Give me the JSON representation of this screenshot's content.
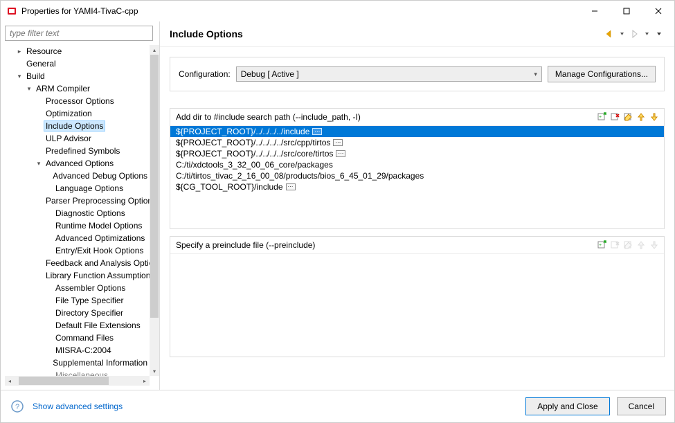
{
  "window": {
    "title": "Properties for YAMI4-TivaC-cpp"
  },
  "filter_placeholder": "type filter text",
  "tree": {
    "resource": "Resource",
    "general": "General",
    "build": "Build",
    "arm_compiler": "ARM Compiler",
    "processor_options": "Processor Options",
    "optimization": "Optimization",
    "include_options": "Include Options",
    "ulp_advisor": "ULP Advisor",
    "predefined_symbols": "Predefined Symbols",
    "advanced_options": "Advanced Options",
    "advanced_debug": "Advanced Debug Options",
    "language_options": "Language Options",
    "parser_preprocessing": "Parser Preprocessing Options",
    "diagnostic_options": "Diagnostic Options",
    "runtime_model": "Runtime Model Options",
    "advanced_optim": "Advanced Optimizations",
    "entry_exit": "Entry/Exit Hook Options",
    "feedback": "Feedback and Analysis Options",
    "library_func": "Library Function Assumptions",
    "assembler": "Assembler Options",
    "file_type": "File Type Specifier",
    "directory_spec": "Directory Specifier",
    "default_file_ext": "Default File Extensions",
    "command_files": "Command Files",
    "misra": "MISRA-C:2004",
    "supplemental": "Supplemental Information",
    "misc": "Miscellaneous"
  },
  "header": {
    "title": "Include Options"
  },
  "config": {
    "label": "Configuration:",
    "value": "Debug  [ Active ]",
    "manage": "Manage Configurations..."
  },
  "include_list": {
    "label": "Add dir to #include search path (--include_path, -I)",
    "items": [
      "${PROJECT_ROOT}/../../../../include",
      "${PROJECT_ROOT}/../../../../src/cpp/tirtos",
      "${PROJECT_ROOT}/../../../../src/core/tirtos",
      "C:/ti/xdctools_3_32_00_06_core/packages",
      "C:/ti/tirtos_tivac_2_16_00_08/products/bios_6_45_01_29/packages",
      "${CG_TOOL_ROOT}/include"
    ]
  },
  "preinclude": {
    "label": "Specify a preinclude file (--preinclude)"
  },
  "footer": {
    "show_adv": "Show advanced settings",
    "apply_close": "Apply and Close",
    "cancel": "Cancel"
  }
}
